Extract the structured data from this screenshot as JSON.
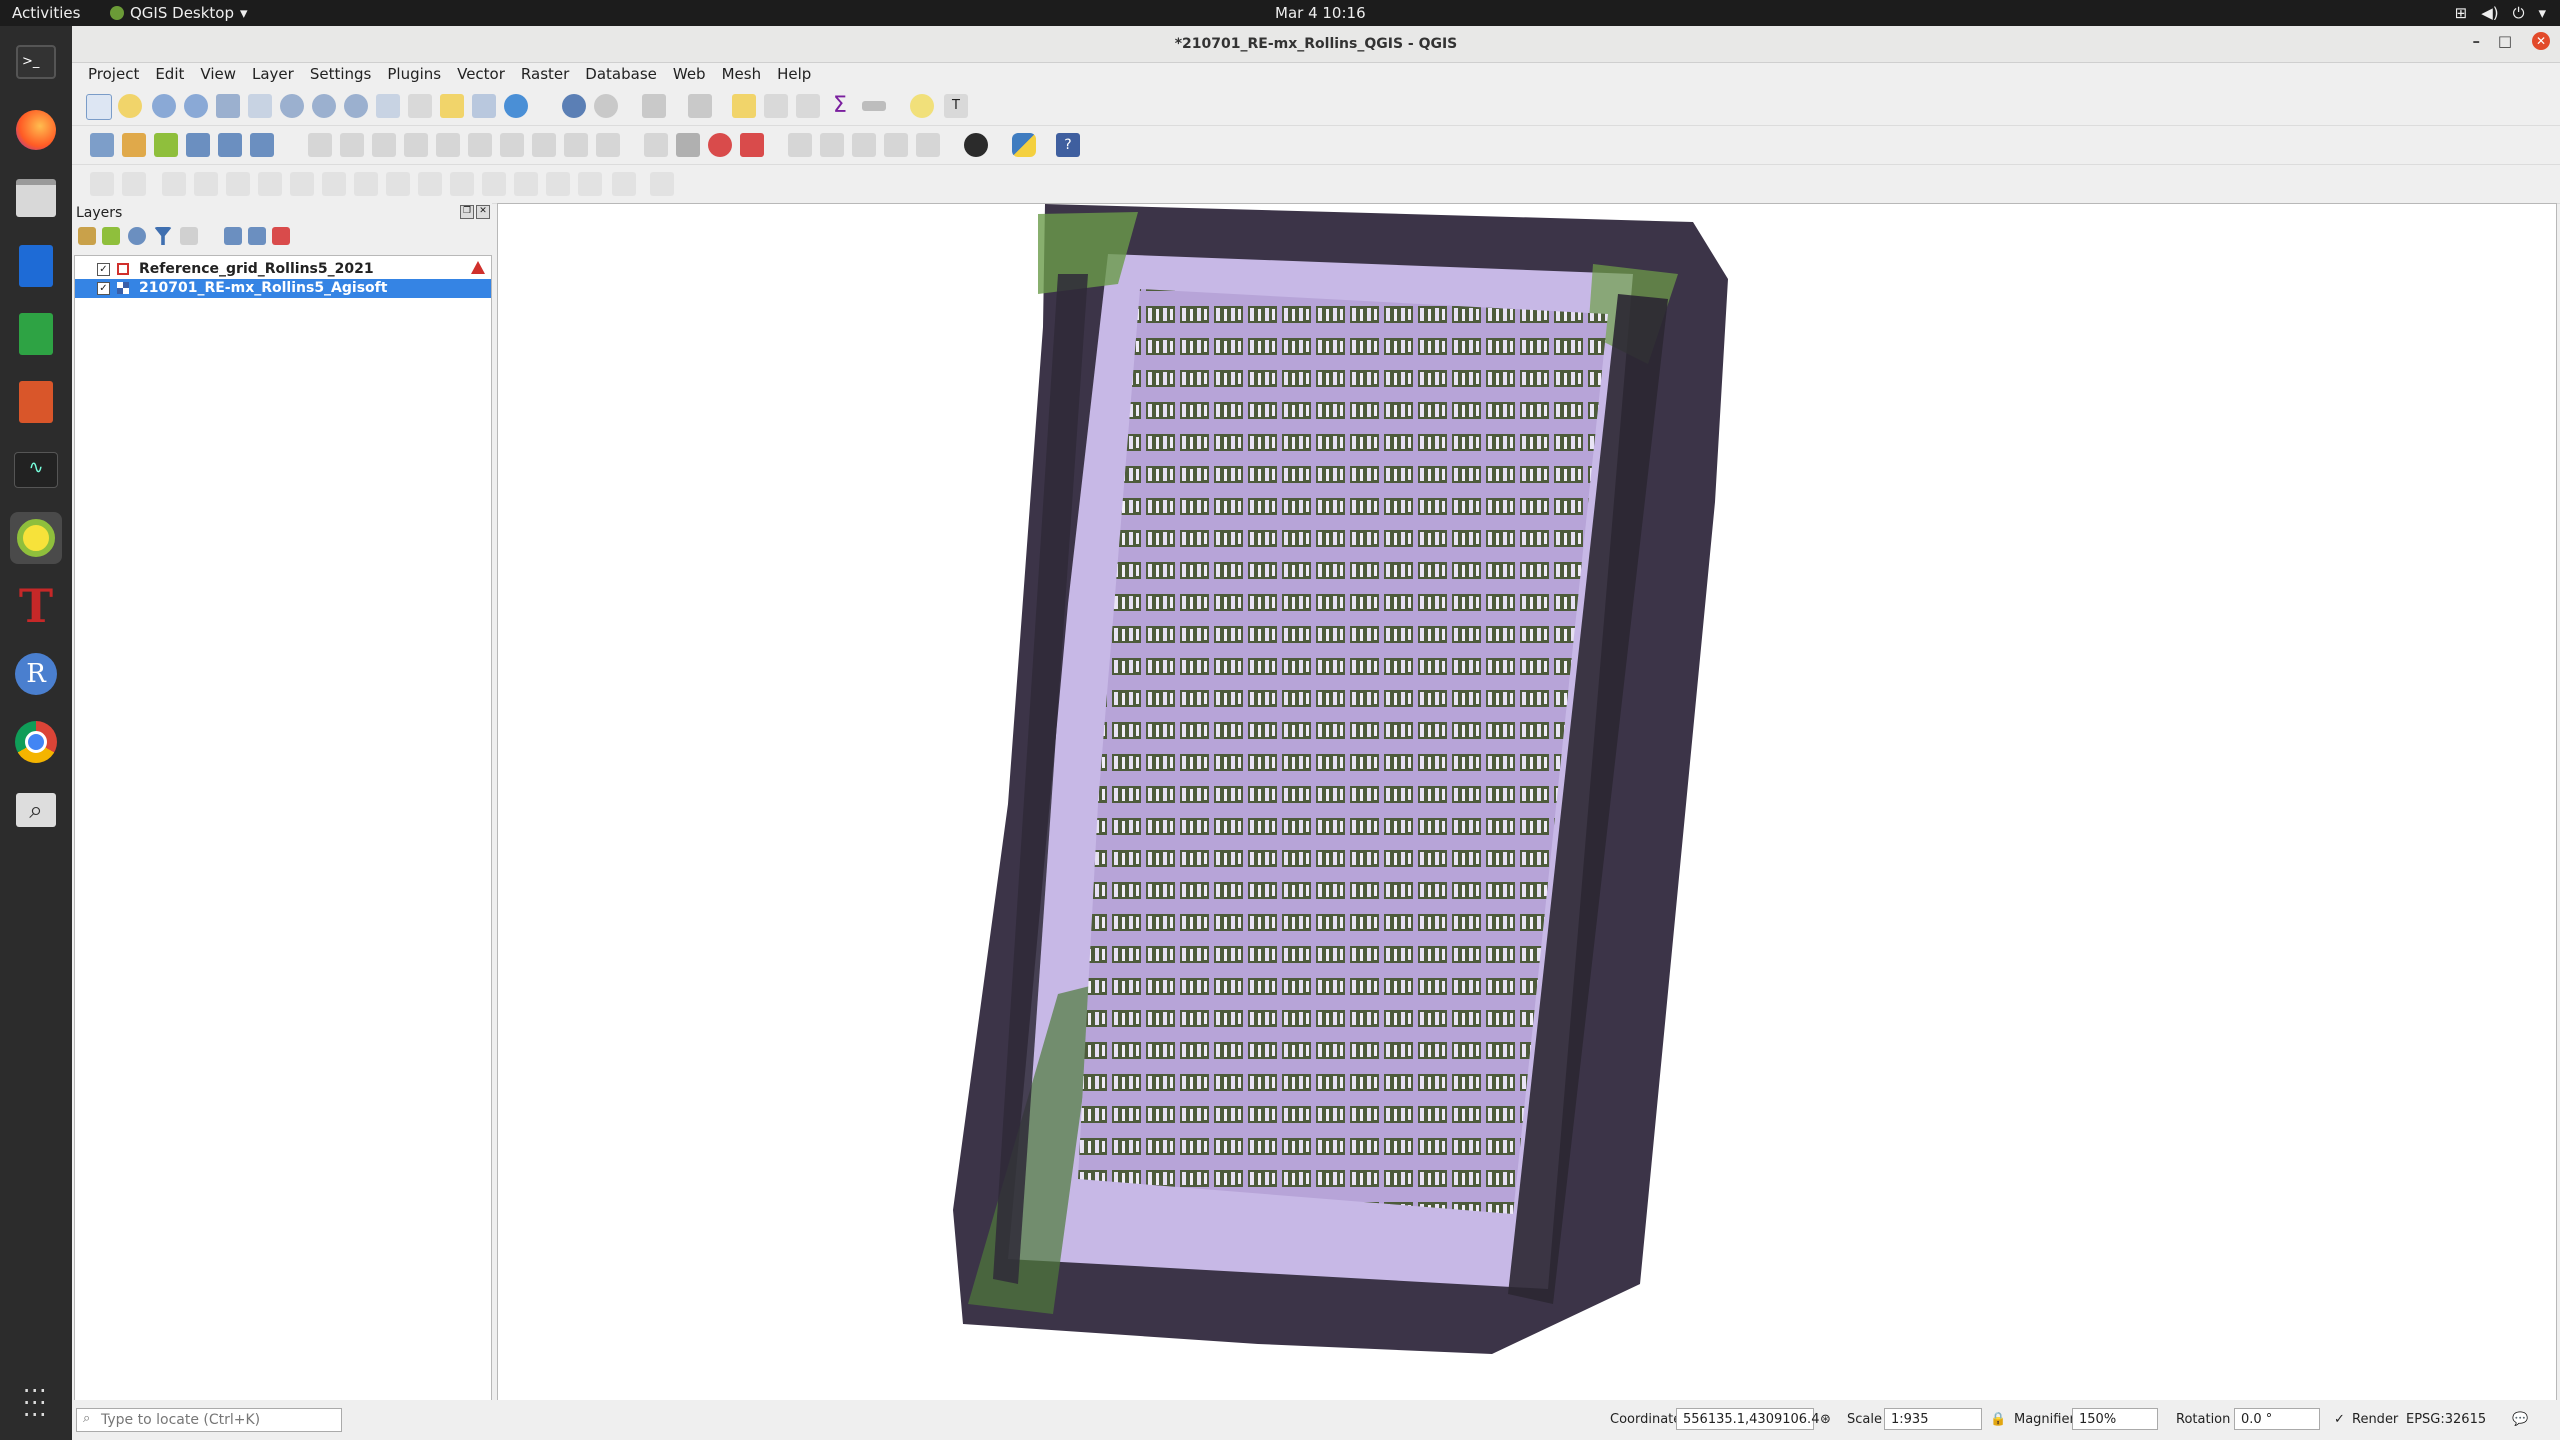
{
  "topbar": {
    "activities": "Activities",
    "app_name": "QGIS Desktop",
    "clock": "Mar 4  10:16"
  },
  "dock": {
    "items": [
      "Terminal",
      "Firefox",
      "Files",
      "Writer",
      "Calc",
      "Impress",
      "System Monitor",
      "QGIS",
      "Typora",
      "R",
      "Chrome",
      "Search",
      "Show Applications"
    ]
  },
  "window": {
    "title": "*210701_RE-mx_Rollins_QGIS - QGIS"
  },
  "menu": [
    "Project",
    "Edit",
    "View",
    "Layer",
    "Settings",
    "Plugins",
    "Vector",
    "Raster",
    "Database",
    "Web",
    "Mesh",
    "Help"
  ],
  "layers_panel": {
    "title": "Layers",
    "layers": [
      {
        "name": "Reference_grid_Rollins5_2021",
        "checked": true,
        "selected": false,
        "warning": true
      },
      {
        "name": "210701_RE-mx_Rollins5_Agisoft",
        "checked": true,
        "selected": true,
        "warning": false
      }
    ]
  },
  "statusbar": {
    "locate_placeholder": "Type to locate (Ctrl+K)",
    "coordinate_label": "Coordinate",
    "coordinate_value": "556135.1,4309106.4",
    "scale_label": "Scale",
    "scale_value": "1:935",
    "magnifier_label": "Magnifier",
    "magnifier_value": "150%",
    "rotation_label": "Rotation",
    "rotation_value": "0.0 °",
    "render_label": "Render",
    "crs": "EPSG:32615"
  },
  "colors": {
    "selection": "#3584e4",
    "dock_bg": "#2c2c2c",
    "topbar_bg": "#1c1c1c"
  }
}
